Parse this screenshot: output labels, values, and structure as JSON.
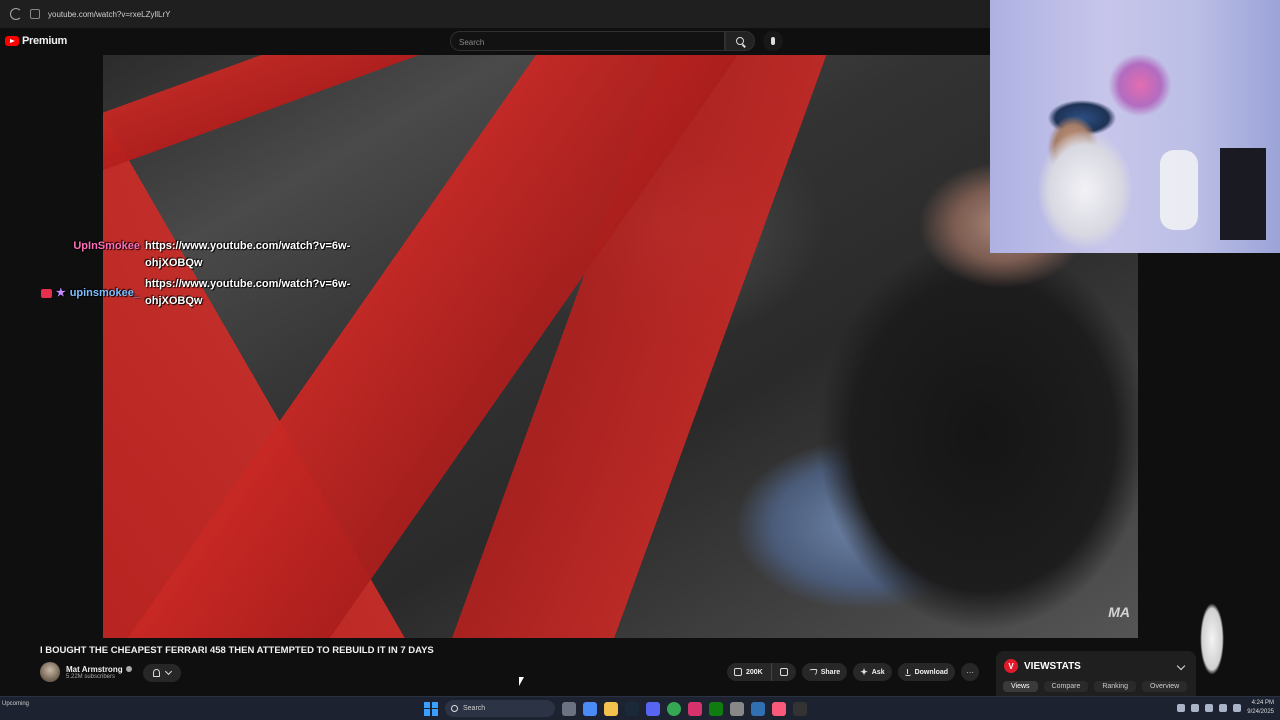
{
  "browser": {
    "url": "youtube.com/watch?v=rxeLZyllLrY"
  },
  "header": {
    "logo_text": "Premium",
    "search_placeholder": "Search"
  },
  "video": {
    "watermark": "MA"
  },
  "chat": [
    {
      "user": "UpInSmokee",
      "message": "https://www.youtube.com/watch?v=6w-ohjXOBQw",
      "color": "#ff6fb8"
    },
    {
      "user": "upinsmokee_",
      "message": "https://www.youtube.com/watch?v=6w-ohjXOBQw",
      "color": "#7fbfff"
    }
  ],
  "video_info": {
    "title": "I BOUGHT THE CHEAPEST FERRARI 458 THEN ATTEMPTED TO REBUILD IT IN 7 DAYS",
    "channel": "Mat Armstrong",
    "subscribers": "5.22M subscribers"
  },
  "actions": {
    "likes": "200K",
    "share": "Share",
    "ask": "Ask",
    "download": "Download",
    "more": "···"
  },
  "viewstats": {
    "logo": "V",
    "title": "VIEWSTATS",
    "tabs": [
      "Views",
      "Compare",
      "Ranking",
      "Overview"
    ],
    "active_tab": "Views"
  },
  "taskbar": {
    "weather": "Upcoming",
    "search_label": "Search",
    "time": "4:24 PM",
    "date": "9/24/2025"
  },
  "colors": {
    "accent": "#ff0000",
    "viewstats": "#e01a2b",
    "taskbar": "#1c2230"
  }
}
